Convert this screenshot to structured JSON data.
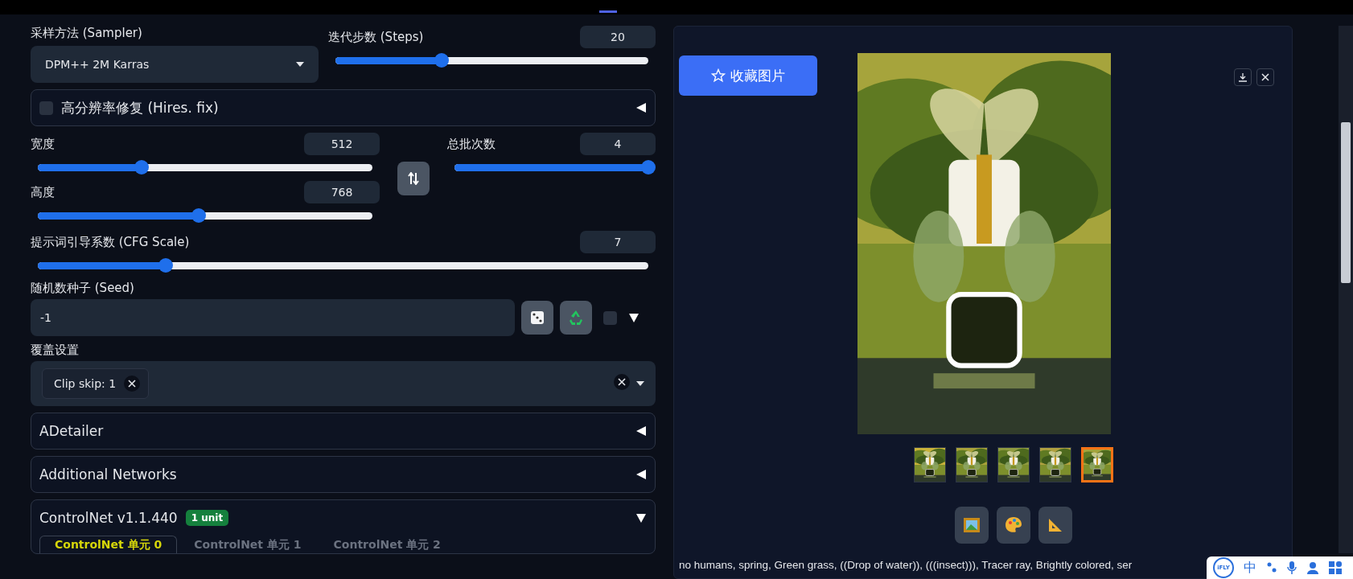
{
  "sampler": {
    "label": "采样方法 (Sampler)",
    "value": "DPM++ 2M Karras"
  },
  "steps": {
    "label": "迭代步数 (Steps)",
    "value": "20",
    "level": 0.34
  },
  "hires_fix": {
    "label": "高分辨率修复 (Hires. fix)",
    "checked": false,
    "expanded": false
  },
  "width": {
    "label": "宽度",
    "value": "512",
    "level": 0.31
  },
  "height": {
    "label": "高度",
    "value": "768",
    "level": 0.48
  },
  "batch_count": {
    "label": "总批次数",
    "value": "4",
    "level": 1
  },
  "cfg_scale": {
    "label": "提示词引导系数 (CFG Scale)",
    "value": "7",
    "level": 0.21
  },
  "seed": {
    "label": "随机数种子 (Seed)",
    "value": "-1",
    "extra_checked": false
  },
  "override": {
    "label": "覆盖设置",
    "tags": [
      "Clip skip: 1"
    ]
  },
  "accordions": [
    {
      "title": "ADetailer",
      "expanded": false
    },
    {
      "title": "Additional Networks",
      "expanded": false
    },
    {
      "title": "ControlNet v1.1.440",
      "badge": "1 unit",
      "expanded": true
    }
  ],
  "controlnet_tabs": [
    {
      "label": "ControlNet 单元 0",
      "selected": true
    },
    {
      "label": "ControlNet 单元 1",
      "selected": false
    },
    {
      "label": "ControlNet 单元 2",
      "selected": false
    }
  ],
  "gallery": {
    "save_button": "收藏图片",
    "thumbnails": [
      {
        "selected": false
      },
      {
        "selected": false
      },
      {
        "selected": false
      },
      {
        "selected": false
      },
      {
        "selected": true
      }
    ]
  },
  "prompt": "no humans, spring, Green grass, ((Drop of water)), (((insect))), Tracer ray, Brightly colored, ser",
  "ime_toolbar": {
    "logo": "iFLY",
    "mode": "中"
  }
}
